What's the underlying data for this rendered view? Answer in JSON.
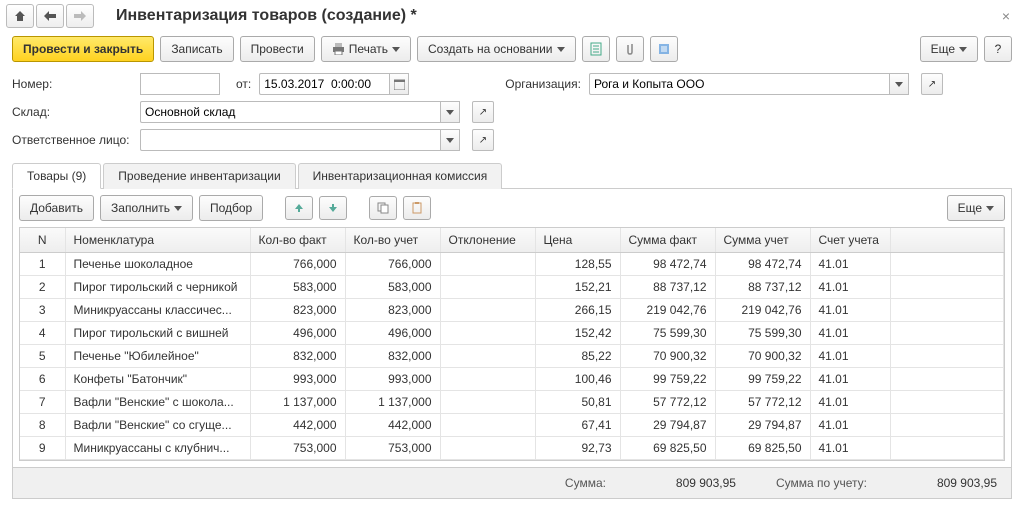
{
  "header": {
    "title": "Инвентаризация товаров (создание) *"
  },
  "toolbar": {
    "post_close": "Провести и закрыть",
    "save": "Записать",
    "post": "Провести",
    "print": "Печать",
    "create_based": "Создать на основании",
    "more": "Еще",
    "help": "?"
  },
  "form": {
    "number_label": "Номер:",
    "number_value": "",
    "date_label": "от:",
    "date_value": "15.03.2017  0:00:00",
    "org_label": "Организация:",
    "org_value": "Рога и Копыта ООО",
    "warehouse_label": "Склад:",
    "warehouse_value": "Основной склад",
    "responsible_label": "Ответственное лицо:",
    "responsible_value": ""
  },
  "tabs": {
    "goods": "Товары (9)",
    "conduct": "Проведение инвентаризации",
    "commission": "Инвентаризационная комиссия"
  },
  "table_toolbar": {
    "add": "Добавить",
    "fill": "Заполнить",
    "select": "Подбор",
    "more": "Еще"
  },
  "columns": {
    "n": "N",
    "nom": "Номенклатура",
    "qty_fact": "Кол-во факт",
    "qty_uchet": "Кол-во учет",
    "deviation": "Отклонение",
    "price": "Цена",
    "sum_fact": "Сумма факт",
    "sum_uchet": "Сумма учет",
    "account": "Счет учета"
  },
  "rows": [
    {
      "n": "1",
      "nom": "Печенье шоколадное",
      "qf": "766,000",
      "qu": "766,000",
      "dev": "",
      "price": "128,55",
      "sf": "98 472,74",
      "su": "98 472,74",
      "acc": "41.01"
    },
    {
      "n": "2",
      "nom": "Пирог тирольский с черникой",
      "qf": "583,000",
      "qu": "583,000",
      "dev": "",
      "price": "152,21",
      "sf": "88 737,12",
      "su": "88 737,12",
      "acc": "41.01"
    },
    {
      "n": "3",
      "nom": "Миникруассаны классичес...",
      "qf": "823,000",
      "qu": "823,000",
      "dev": "",
      "price": "266,15",
      "sf": "219 042,76",
      "su": "219 042,76",
      "acc": "41.01"
    },
    {
      "n": "4",
      "nom": "Пирог тирольский с вишней",
      "qf": "496,000",
      "qu": "496,000",
      "dev": "",
      "price": "152,42",
      "sf": "75 599,30",
      "su": "75 599,30",
      "acc": "41.01"
    },
    {
      "n": "5",
      "nom": "Печенье \"Юбилейное\"",
      "qf": "832,000",
      "qu": "832,000",
      "dev": "",
      "price": "85,22",
      "sf": "70 900,32",
      "su": "70 900,32",
      "acc": "41.01"
    },
    {
      "n": "6",
      "nom": "Конфеты \"Батончик\"",
      "qf": "993,000",
      "qu": "993,000",
      "dev": "",
      "price": "100,46",
      "sf": "99 759,22",
      "su": "99 759,22",
      "acc": "41.01"
    },
    {
      "n": "7",
      "nom": "Вафли \"Венские\" с шокола...",
      "qf": "1 137,000",
      "qu": "1 137,000",
      "dev": "",
      "price": "50,81",
      "sf": "57 772,12",
      "su": "57 772,12",
      "acc": "41.01"
    },
    {
      "n": "8",
      "nom": "Вафли \"Венские\" со сгуще...",
      "qf": "442,000",
      "qu": "442,000",
      "dev": "",
      "price": "67,41",
      "sf": "29 794,87",
      "su": "29 794,87",
      "acc": "41.01"
    },
    {
      "n": "9",
      "nom": "Миникруассаны с клубнич...",
      "qf": "753,000",
      "qu": "753,000",
      "dev": "",
      "price": "92,73",
      "sf": "69 825,50",
      "su": "69 825,50",
      "acc": "41.01"
    }
  ],
  "footer": {
    "sum_label": "Сумма:",
    "sum_value": "809 903,95",
    "sum_uchet_label": "Сумма по учету:",
    "sum_uchet_value": "809 903,95"
  }
}
